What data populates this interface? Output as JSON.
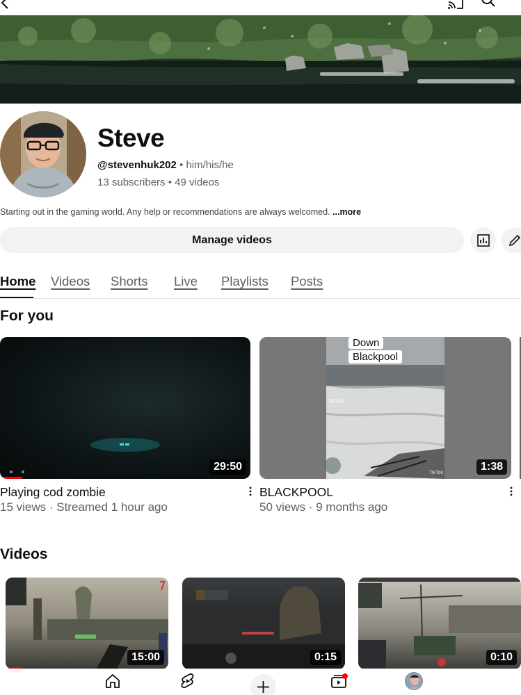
{
  "channel": {
    "name": "Steve",
    "handle": "@stevenhuk202",
    "separator": " • ",
    "pronouns": "him/his/he",
    "subscribers": "13 subscribers",
    "videos_count": "49 videos",
    "description": "Starting out in the gaming world. Any help or recommendations are always welcomed.",
    "more_label": "...more"
  },
  "actions": {
    "manage_label": "Manage videos"
  },
  "tabs": [
    {
      "label": "Home",
      "active": true
    },
    {
      "label": "Videos"
    },
    {
      "label": "Shorts"
    },
    {
      "label": "Live"
    },
    {
      "label": "Playlists"
    },
    {
      "label": "Posts"
    }
  ],
  "for_you": {
    "title": "For you",
    "items": [
      {
        "title": "Playing cod zombie",
        "meta": "15 views · Streamed 1 hour ago",
        "duration": "29:50",
        "watched_fraction": 0.09
      },
      {
        "title": "BLACKPOOL",
        "meta": "50 views · 9 months ago",
        "duration": "1:38",
        "overlay_line1": "Down",
        "overlay_line2": "Blackpool",
        "watermark": "TikTok"
      }
    ]
  },
  "videos": {
    "title": "Videos",
    "items": [
      {
        "duration": "15:00",
        "watched_fraction": 0.1
      },
      {
        "duration": "0:15"
      },
      {
        "duration": "0:10"
      }
    ]
  },
  "icons": {
    "back": "back-arrow-icon",
    "cast": "cast-icon",
    "search": "search-icon",
    "analytics": "analytics-icon",
    "edit": "pencil-icon",
    "kebab": "more-vert-icon",
    "nav_home": "home-icon",
    "nav_shorts": "shorts-icon",
    "nav_create": "plus-icon",
    "nav_subscriptions": "subscriptions-icon",
    "nav_you": "avatar-icon"
  },
  "colors": {
    "accent": "#ff0000",
    "text": "#0f0f0f",
    "muted": "#606060",
    "button_bg": "#f2f2f2"
  }
}
